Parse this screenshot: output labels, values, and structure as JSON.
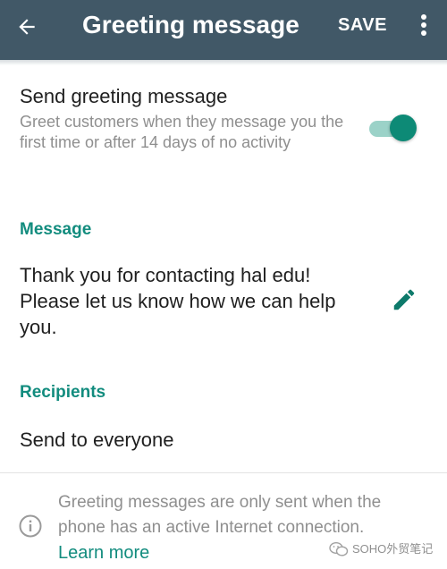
{
  "app_bar": {
    "title": "Greeting message",
    "save_label": "SAVE",
    "back_icon": "arrow-back-icon",
    "more_icon": "more-vert-icon",
    "background_color": "#415867"
  },
  "greeting_setting": {
    "title": "Send greeting message",
    "description": "Greet customers when they message you the first time or after 14 days of no activity",
    "enabled": true,
    "toggle_color": "#0d8a76"
  },
  "message_section": {
    "header": "Message",
    "text": "Thank you for contacting hal edu! Please let us know how we can help you.",
    "edit_icon": "pencil-icon"
  },
  "recipients_section": {
    "header": "Recipients",
    "value": "Send to everyone"
  },
  "info_footer": {
    "text": "Greeting messages are only sent when the phone has an active Internet connection.",
    "link": "Learn more",
    "icon": "info-icon"
  },
  "watermark": {
    "text": "SOHO外贸笔记"
  },
  "accent_color": "#128c7e"
}
